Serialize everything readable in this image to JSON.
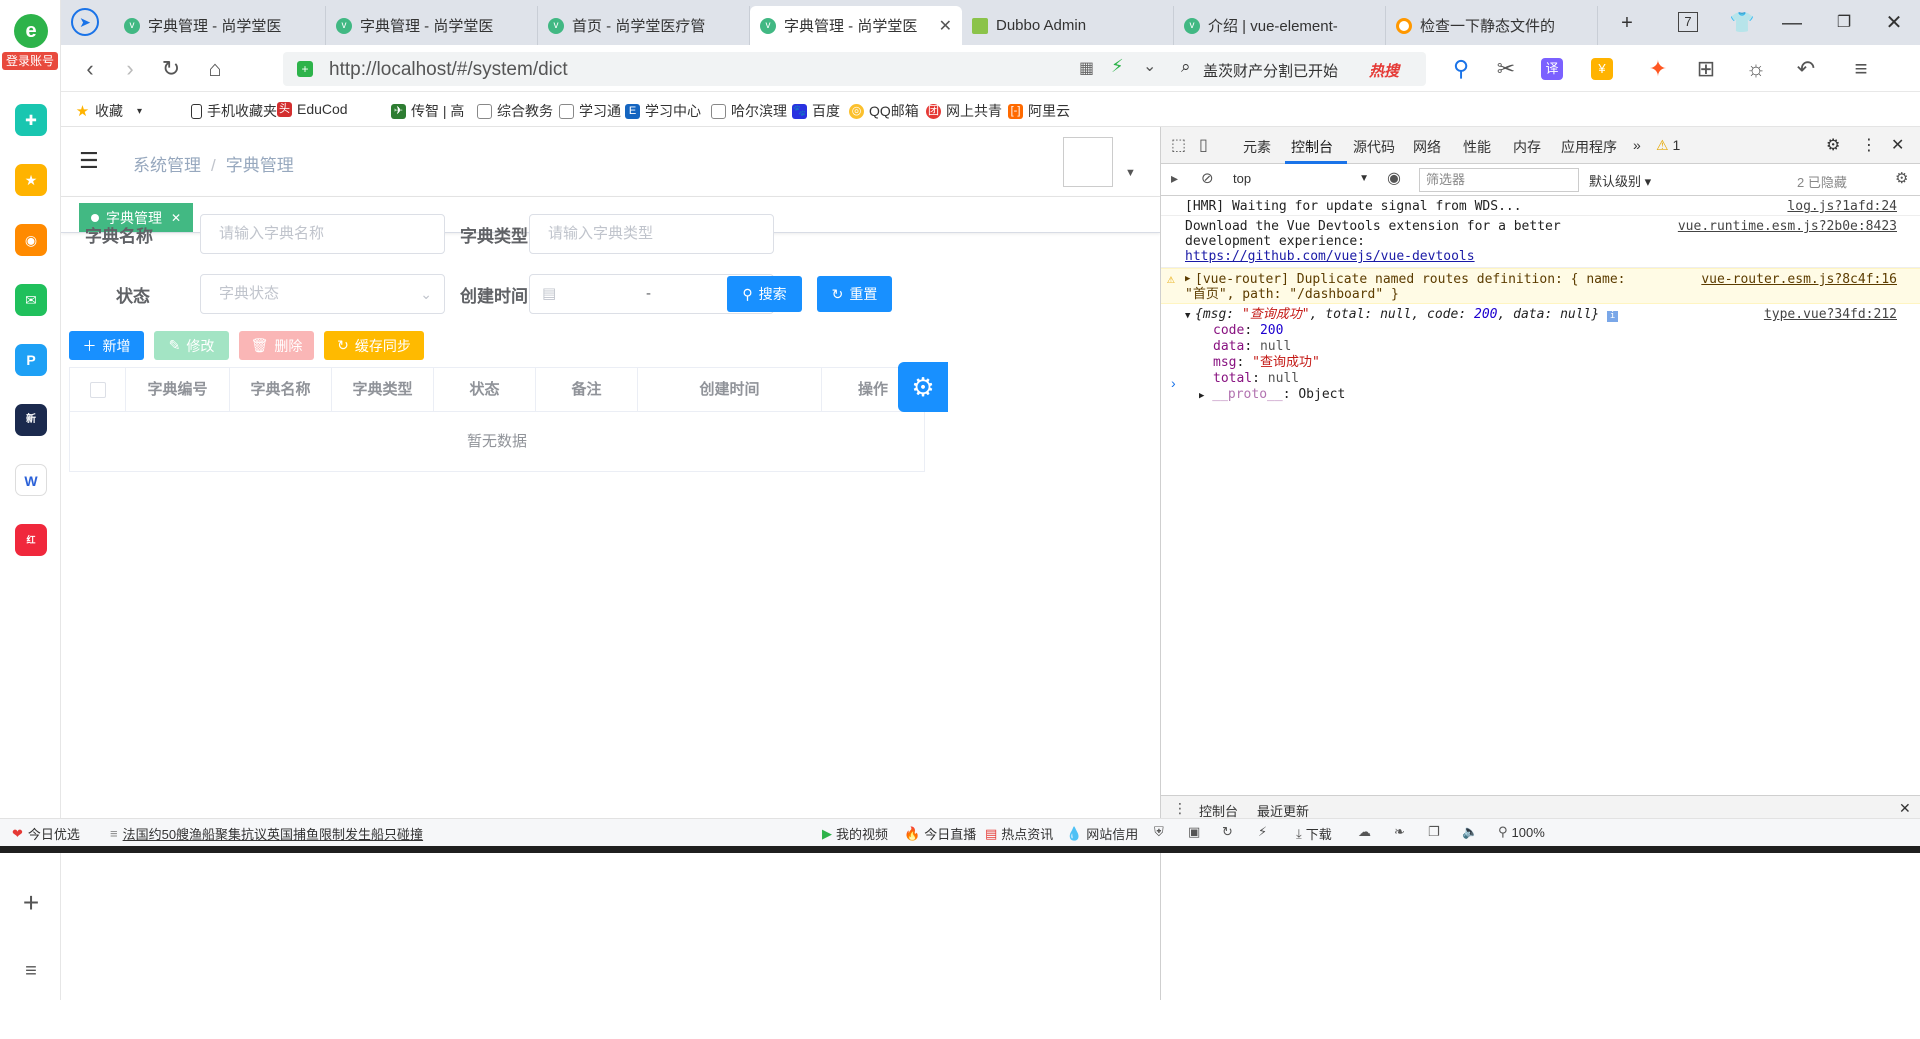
{
  "browser": {
    "tabs": [
      {
        "title": "字典管理 - 尚学堂医"
      },
      {
        "title": "字典管理 - 尚学堂医"
      },
      {
        "title": "首页 - 尚学堂医疗管"
      },
      {
        "title": "字典管理 - 尚学堂医",
        "active": true
      },
      {
        "title": "Dubbo Admin"
      },
      {
        "title": "介绍 | vue-element-"
      },
      {
        "title": "检查一下静态文件的"
      }
    ],
    "tab_count": "7",
    "url": "http://localhost/#/system/dict",
    "search_hint": "盖茨财产分割已开始",
    "search_hot": "热搜",
    "login_label": "登录账号",
    "bookmarks": [
      "收藏",
      "手机收藏夹",
      "EduCod",
      "传智 | 高",
      "综合教务",
      "学习通",
      "学习中心",
      "哈尔滨理",
      "百度",
      "QQ邮箱",
      "网上共青",
      "阿里云"
    ]
  },
  "app": {
    "breadcrumb": [
      "系统管理",
      "字典管理"
    ],
    "tag_label": "字典管理",
    "form": {
      "dict_name_label": "字典名称",
      "dict_name_placeholder": "请输入字典名称",
      "dict_type_label": "字典类型",
      "dict_type_placeholder": "请输入字典类型",
      "status_label": "状态",
      "status_placeholder": "字典状态",
      "created_label": "创建时间",
      "range_separator": "-",
      "search_btn": "搜索",
      "reset_btn": "重置"
    },
    "toolbar": {
      "add": "新增",
      "edit": "修改",
      "delete": "删除",
      "sync": "缓存同步"
    },
    "table": {
      "columns": [
        "字典编号",
        "字典名称",
        "字典类型",
        "状态",
        "备注",
        "创建时间",
        "操作"
      ],
      "empty_text": "暂无数据"
    }
  },
  "devtools": {
    "tabs": [
      "元素",
      "控制台",
      "源代码",
      "网络",
      "性能",
      "内存",
      "应用程序"
    ],
    "active_tab": "控制台",
    "warning_count": "1",
    "context": "top",
    "filter_placeholder": "筛选器",
    "level": "默认级别",
    "hidden": "2 已隐藏",
    "console": {
      "l1_text": "[HMR] Waiting for update signal from WDS...",
      "l1_src": "log.js?1afd:24",
      "l2_text_a": "Download the Vue Devtools extension for a better",
      "l2_text_b": "development experience:",
      "l2_link": "https://github.com/vuejs/vue-devtools",
      "l2_src": "vue.runtime.esm.js?2b0e:8423",
      "l3_text_a": "[vue-router] Duplicate named routes definition: { name:",
      "l3_text_b": "\"首页\", path: \"/dashboard\" }",
      "l3_src": "vue-router.esm.js?8c4f:16",
      "l4_summary_pre": "{msg: ",
      "l4_msg_val": "\"查询成功\"",
      "l4_summary_mid": ", total: null, code: ",
      "l4_code_val": "200",
      "l4_summary_post": ", data: null}",
      "l4_src": "type.vue?34fd:212",
      "props": [
        {
          "key": "code",
          "val": "200"
        },
        {
          "key": "data",
          "val": "null"
        },
        {
          "key": "msg",
          "val": "\"查询成功\""
        },
        {
          "key": "total",
          "val": "null"
        }
      ],
      "proto_key": "__proto__",
      "proto_val": "Object"
    },
    "drawer_tabs": [
      "控制台",
      "最近更新"
    ]
  },
  "statusbar": {
    "left1": "今日优选",
    "news": "法国约50艘渔船聚集抗议英国捕鱼限制发生船只碰撞",
    "video": "我的视频",
    "live": "今日直播",
    "hotnews": "热点资讯",
    "credit": "网站信用",
    "download": "下载",
    "zoom": "100%"
  },
  "colors": {
    "primary": "#1890ff",
    "success": "#42b983",
    "edit_disabled": "#a3e4c4",
    "delete_disabled": "#fab6b6",
    "warning": "#ffba00"
  }
}
